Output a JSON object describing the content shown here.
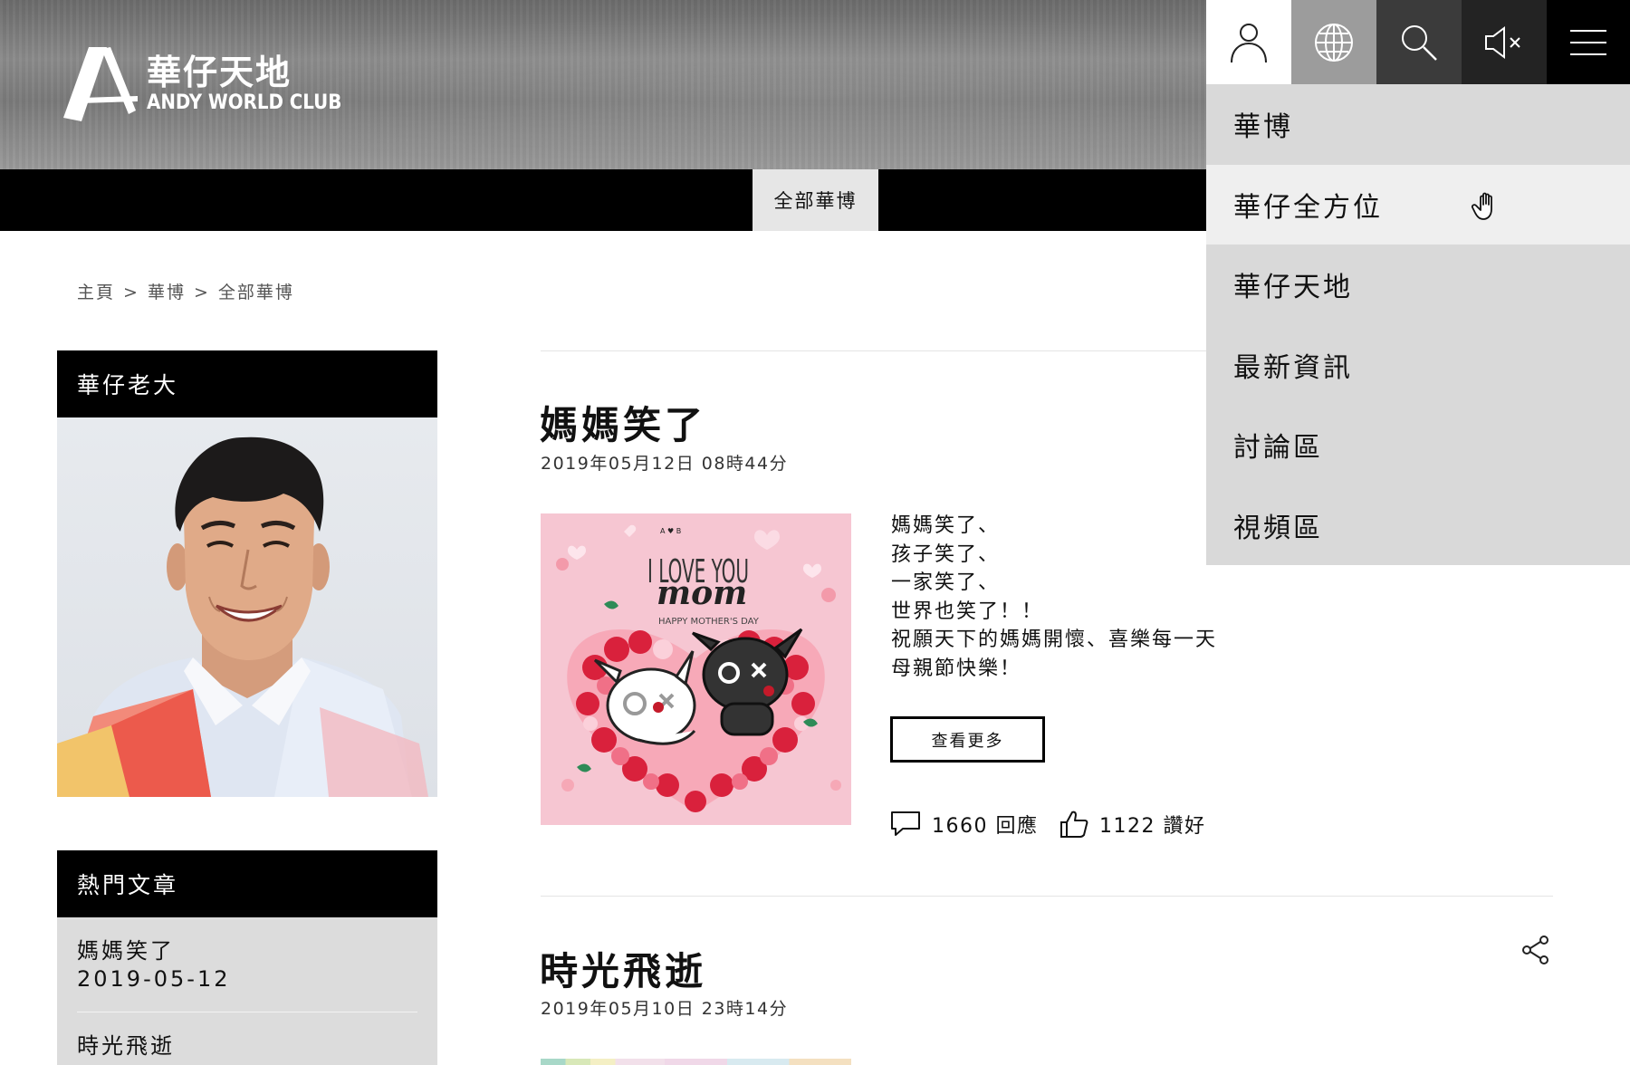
{
  "logo": {
    "cn": "華仔天地",
    "en": "ANDY WORLD CLUB"
  },
  "nav": {
    "active_tab": "全部華博"
  },
  "topbar_icons": [
    "user-icon",
    "globe-icon",
    "search-icon",
    "mute-icon",
    "hamburger-menu-icon"
  ],
  "menu": {
    "items": [
      {
        "label": "華博"
      },
      {
        "label": "華仔全方位"
      },
      {
        "label": "華仔天地"
      },
      {
        "label": "最新資訊"
      },
      {
        "label": "討論區"
      },
      {
        "label": "視頻區"
      }
    ]
  },
  "breadcrumb": {
    "items": [
      "主頁",
      "華博",
      "全部華博"
    ],
    "separator": ">"
  },
  "sidebar": {
    "profile_title": "華仔老大",
    "hot_title": "熱門文章",
    "hot_articles": [
      {
        "title": "媽媽笑了",
        "date": "2019-05-12"
      },
      {
        "title": "時光飛逝",
        "date": ""
      }
    ]
  },
  "posts": [
    {
      "title": "媽媽笑了",
      "date": "2019年05月12日 08時44分",
      "image": {
        "line1": "I LOVE YOU",
        "line2": "mom",
        "line3": "HAPPY MOTHER'S DAY"
      },
      "body": [
        "媽媽笑了、",
        "孩子笑了、",
        "一家笑了、",
        "世界也笑了！！",
        "祝願天下的媽媽開懷、喜樂每一天",
        "母親節快樂！"
      ],
      "more_label": "查看更多",
      "comments": "1660 回應",
      "likes": "1122 讚好"
    },
    {
      "title": "時光飛逝",
      "date": "2019年05月10日 23時14分"
    }
  ],
  "colors": {
    "header_gray": "#7a7a7a",
    "nav_black": "#000000",
    "menu_bg": "#d9d9d9",
    "menu_hover": "#efefef",
    "card_pink": "#f6c4cf"
  }
}
